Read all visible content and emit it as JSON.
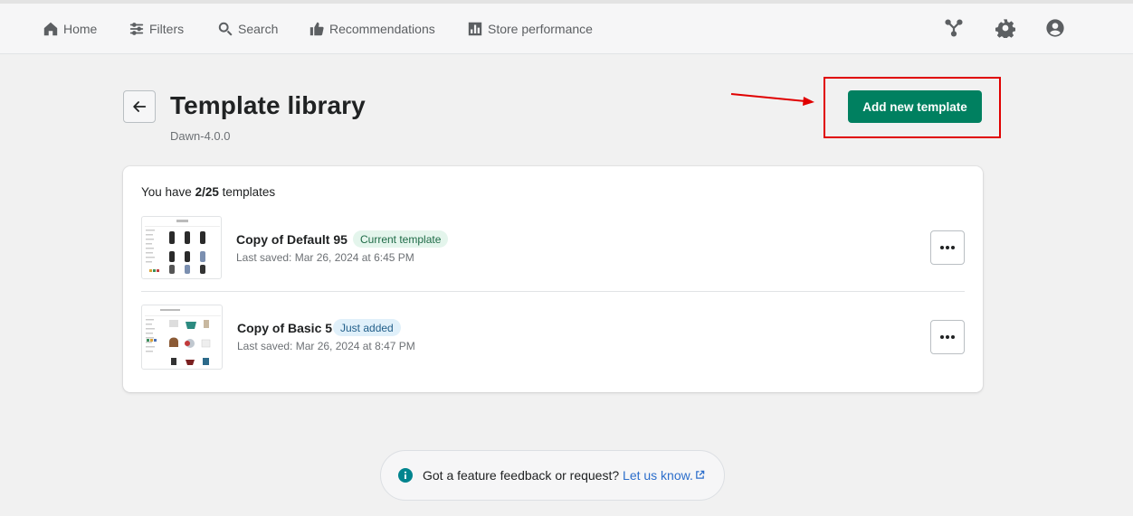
{
  "nav": {
    "items": [
      {
        "label": "Home",
        "icon": "home-icon"
      },
      {
        "label": "Filters",
        "icon": "filters-icon"
      },
      {
        "label": "Search",
        "icon": "search-icon"
      },
      {
        "label": "Recommendations",
        "icon": "thumbs-up-icon"
      },
      {
        "label": "Store performance",
        "icon": "bar-chart-icon"
      }
    ],
    "right_icons": [
      "integrations-icon",
      "gear-icon",
      "account-icon"
    ]
  },
  "header": {
    "title": "Template library",
    "subtitle": "Dawn-4.0.0",
    "add_button": "Add new template"
  },
  "card": {
    "count_prefix": "You have ",
    "count_value": "2/25",
    "count_suffix": " templates",
    "templates": [
      {
        "name": "Copy of Default 95",
        "badge": "Current template",
        "saved": "Last saved: Mar 26, 2024 at 6:45 PM"
      },
      {
        "name": "Copy of Basic 5",
        "badge": "Just added",
        "saved": "Last saved: Mar 26, 2024 at 8:47 PM"
      }
    ]
  },
  "feedback": {
    "text": "Got a feature feedback or request?",
    "link": "Let us know."
  },
  "colors": {
    "primary": "#008060",
    "highlight": "#e00000",
    "link": "#2c6ecb"
  }
}
